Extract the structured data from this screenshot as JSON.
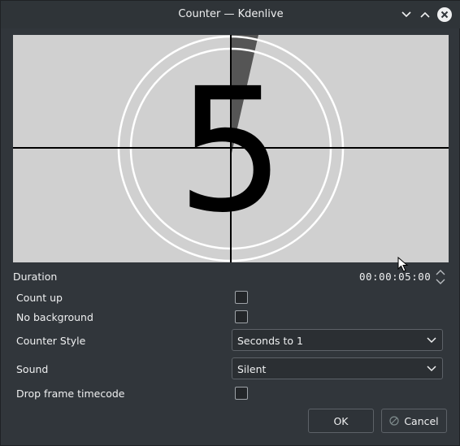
{
  "window": {
    "title": "Counter — Kdenlive"
  },
  "preview": {
    "number": "5"
  },
  "duration": {
    "label": "Duration",
    "value": "00:00:05:00"
  },
  "options": {
    "count_up_label": "Count up",
    "no_background_label": "No background",
    "counter_style_label": "Counter Style",
    "counter_style_value": "Seconds to 1",
    "sound_label": "Sound",
    "sound_value": "Silent",
    "drop_frame_label": "Drop frame timecode"
  },
  "buttons": {
    "ok_label": "OK",
    "cancel_label": "Cancel"
  },
  "icons": {
    "minimize": "chevron-down-icon",
    "maximize": "chevron-up-icon",
    "close": "close-icon"
  }
}
